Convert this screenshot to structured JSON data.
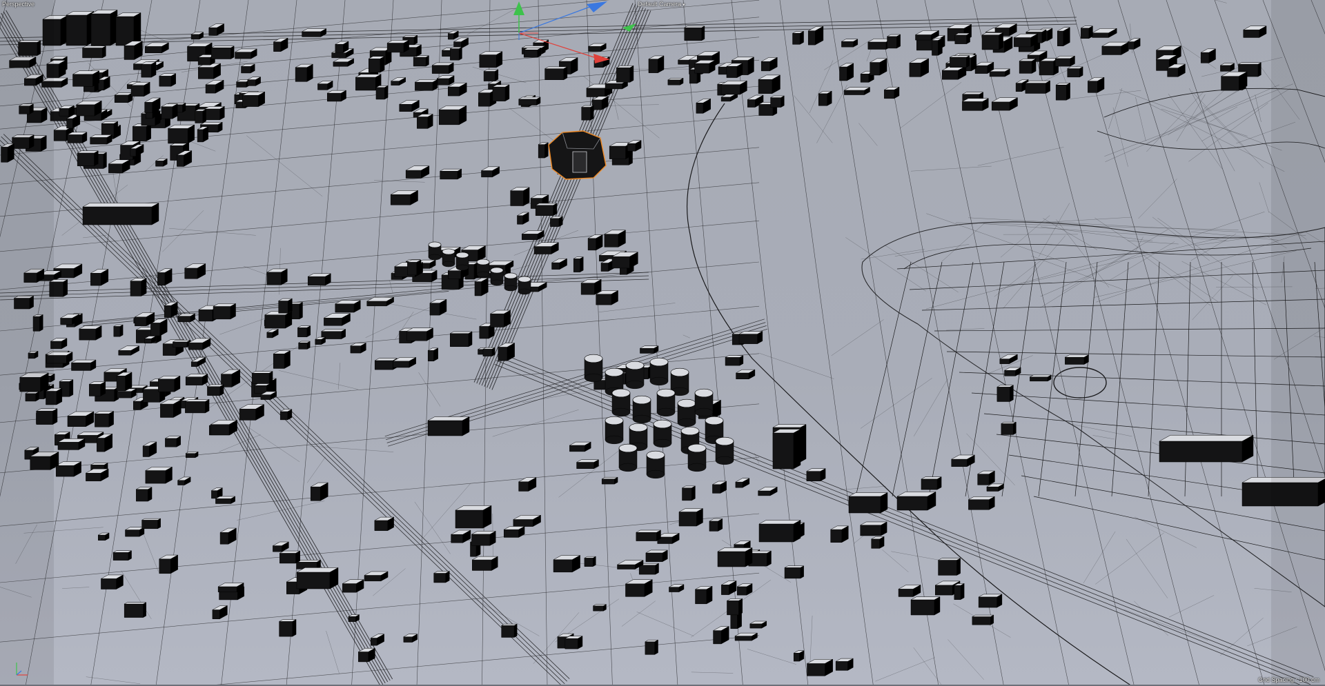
{
  "viewport": {
    "view_name": "Perspective",
    "camera_name": "Default Camera",
    "camera_menu_arrow": "▾",
    "grid_spacing": "Grid Spacing : 100 cm"
  },
  "icons": {
    "gizmo": "move-gizmo-icon",
    "axis": "world-axis-icon"
  },
  "colors": {
    "background": "#a8acb6",
    "wire": "#1a1a1c",
    "building": "#141415",
    "building_top": "#d9dbe0",
    "selection": "#f08a24",
    "axis_x": "#e0413b",
    "axis_y": "#3ec24c",
    "axis_z": "#3a78e0"
  }
}
